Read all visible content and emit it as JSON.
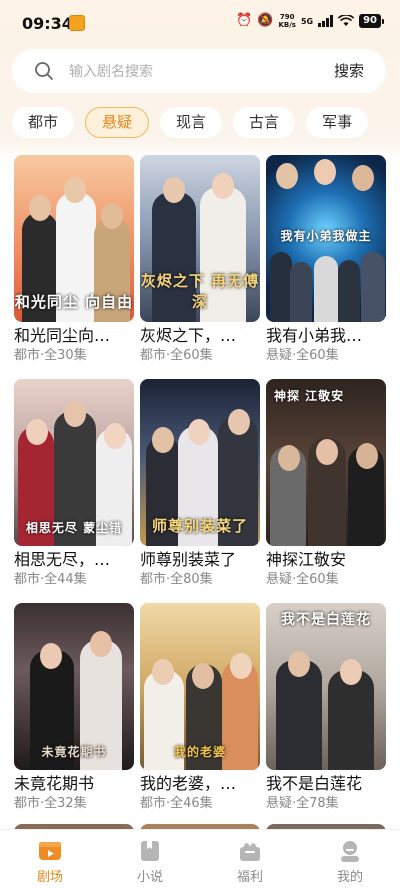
{
  "status_bar": {
    "time": "09:34",
    "net_speed_value": "790",
    "net_speed_unit": "KB/s",
    "network": "5G",
    "battery": "90"
  },
  "search": {
    "placeholder": "输入剧名搜索",
    "button_label": "搜索"
  },
  "tabs": [
    {
      "label": "都市",
      "active": false
    },
    {
      "label": "悬疑",
      "active": true
    },
    {
      "label": "现言",
      "active": false
    },
    {
      "label": "古言",
      "active": false
    },
    {
      "label": "军事",
      "active": false
    }
  ],
  "dramas": [
    {
      "title": "和光同尘向…",
      "meta": "都市·全30集",
      "poster_text": "和光同尘 向自由"
    },
    {
      "title": "灰烬之下，…",
      "meta": "都市·全60集",
      "poster_text": "灰烬之下 再无傅深"
    },
    {
      "title": "我有小弟我…",
      "meta": "悬疑·全60集",
      "poster_text": "我有小弟我做主"
    },
    {
      "title": "相思无尽，…",
      "meta": "都市·全44集",
      "poster_text": "相思无尽 蒙尘错"
    },
    {
      "title": "师尊别装菜了",
      "meta": "都市·全80集",
      "poster_text": "师尊别装菜了"
    },
    {
      "title": "神探江敬安",
      "meta": "悬疑·全60集",
      "poster_text": "神探 江敬安"
    },
    {
      "title": "未竟花期书",
      "meta": "都市·全32集",
      "poster_text": "未竟花期书"
    },
    {
      "title": "我的老婆，…",
      "meta": "都市·全46集",
      "poster_text": "我的老婆"
    },
    {
      "title": "我不是白莲花",
      "meta": "悬疑·全78集",
      "poster_text": "我不是白莲花"
    }
  ],
  "bottom_nav": [
    {
      "label": "剧场",
      "icon": "theater-icon",
      "active": true
    },
    {
      "label": "小说",
      "icon": "book-icon",
      "active": false
    },
    {
      "label": "福利",
      "icon": "gift-icon",
      "active": false
    },
    {
      "label": "我的",
      "icon": "profile-icon",
      "active": false
    }
  ],
  "colors": {
    "accent": "#e9871b",
    "tab_active_bg": "#fdf1dc",
    "tab_active_border": "#f2b95a"
  }
}
